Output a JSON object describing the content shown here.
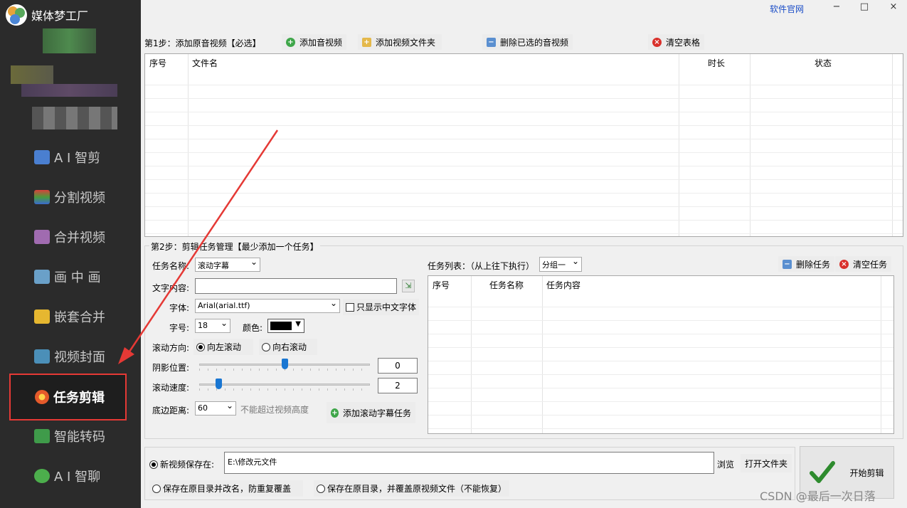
{
  "sidebar": {
    "app_title": "媒体梦工厂",
    "items": [
      {
        "label": "A I 智剪",
        "icon": "ai-cut-icon",
        "color": "#4a7fd0"
      },
      {
        "label": "分割视频",
        "icon": "split-video-icon",
        "color": "#d9403b"
      },
      {
        "label": "合并视频",
        "icon": "merge-video-icon",
        "color": "#a06bb0"
      },
      {
        "label": "画 中 画",
        "icon": "picture-in-picture-icon",
        "color": "#6aa0c8"
      },
      {
        "label": "嵌套合并",
        "icon": "nested-merge-icon",
        "color": "#e6b730"
      },
      {
        "label": "视频封面",
        "icon": "video-cover-icon",
        "color": "#4b8fb8"
      },
      {
        "label": "任务剪辑",
        "icon": "flower-icon",
        "color": "#e55a2b"
      },
      {
        "label": "智能转码",
        "icon": "smart-transcode-icon",
        "color": "#3f9b4a"
      },
      {
        "label": "A I 智聊",
        "icon": "ai-chat-icon",
        "color": "#4cae4c"
      }
    ]
  },
  "window": {
    "website_link": "软件官网",
    "minimize": "−",
    "maximize": "□",
    "close": "×"
  },
  "step1": {
    "title": "第1步：添加原音视频【必选】",
    "add_av": "添加音视频",
    "add_folder": "添加视频文件夹",
    "delete_selected": "删除已选的音视频",
    "clear_table": "清空表格",
    "columns": {
      "index": "序号",
      "filename": "文件名",
      "duration": "时长",
      "status": "状态"
    }
  },
  "step2": {
    "title": "第2步：剪辑任务管理【最少添加一个任务】",
    "task_name_label": "任务名称:",
    "task_name_value": "滚动字幕",
    "text_label": "文字内容:",
    "text_value": "",
    "font_label": "字体:",
    "font_value": "Arial(arial.ttf)",
    "cn_only_label": "只显示中文字体",
    "size_label": "字号:",
    "size_value": "18",
    "color_label": "颜色:",
    "color_value": "#000000",
    "direction_label": "滚动方向:",
    "dir_left": "向左滚动",
    "dir_right": "向右滚动",
    "shadow_label": "阴影位置:",
    "shadow_value": "0",
    "shadow_fraction": 0.5,
    "speed_label": "滚动速度:",
    "speed_value": "2",
    "speed_fraction": 0.1,
    "bottom_label": "底边距离:",
    "bottom_value": "60",
    "bottom_hint": "不能超过视频高度",
    "add_task": "添加滚动字幕任务",
    "list_label": "任务列表：（从上往下执行）",
    "group_value": "分组一",
    "delete_task": "删除任务",
    "clear_task": "清空任务",
    "columns": {
      "index": "序号",
      "name": "任务名称",
      "content": "任务内容"
    }
  },
  "output": {
    "save_new_label": "新视频保存在:",
    "save_path": "E:\\修改元文件",
    "browse": "浏览",
    "open_folder": "打开文件夹",
    "save_rename": "保存在原目录并改名，防重复覆盖",
    "save_overwrite": "保存在原目录，并覆盖原视频文件（不能恢复）",
    "start": "开始剪辑"
  },
  "watermark": "CSDN @最后一次日落"
}
